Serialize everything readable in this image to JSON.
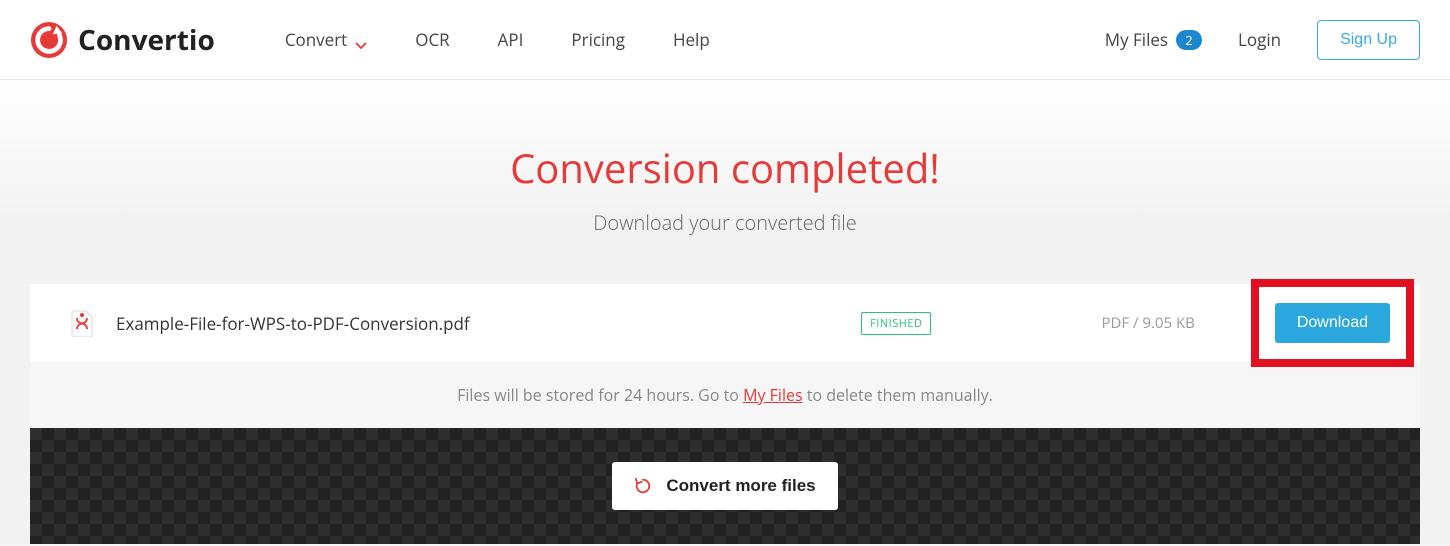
{
  "header": {
    "brand": "Convertio",
    "nav": {
      "convert": "Convert",
      "ocr": "OCR",
      "api": "API",
      "pricing": "Pricing",
      "help": "Help"
    },
    "right": {
      "myfiles": "My Files",
      "badge": "2",
      "login": "Login",
      "signup": "Sign Up"
    }
  },
  "main": {
    "title": "Conversion completed!",
    "subtitle": "Download your converted file"
  },
  "file": {
    "name": "Example-File-for-WPS-to-PDF-Conversion.pdf",
    "status": "FINISHED",
    "meta": "PDF / 9.05 KB",
    "download": "Download"
  },
  "note": {
    "prefix": "Files will be stored for 24 hours. Go to ",
    "link": "My Files",
    "suffix": " to delete them manually."
  },
  "footer": {
    "convert_more": "Convert more files"
  }
}
